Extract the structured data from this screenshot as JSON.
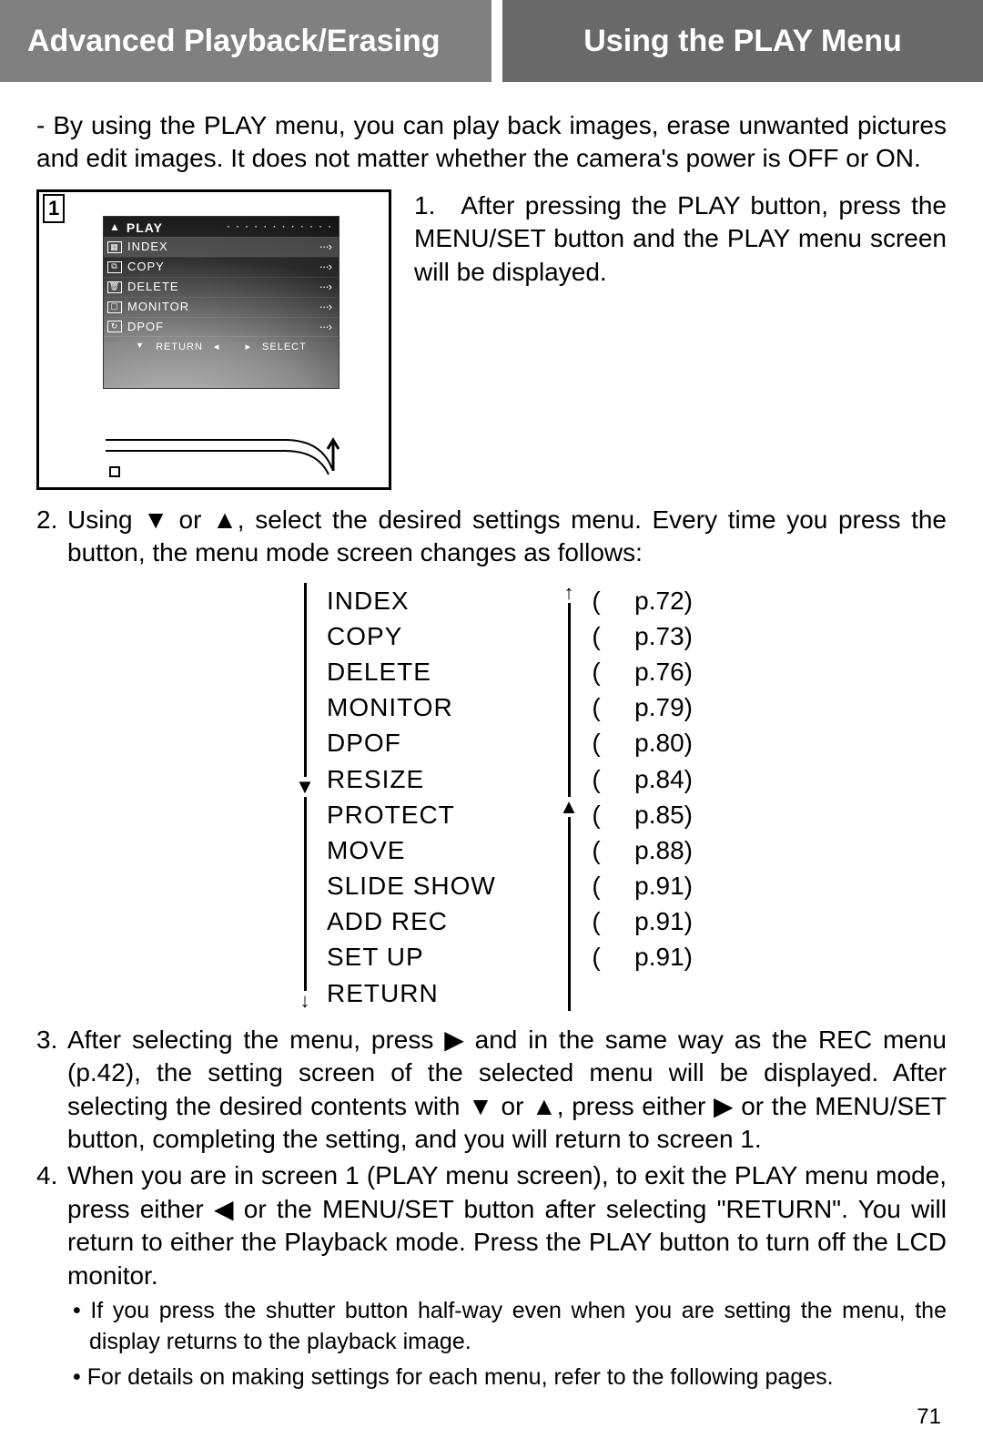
{
  "header": {
    "left": "Advanced Playback/Erasing",
    "right": "Using the PLAY Menu"
  },
  "intro": "- By using the PLAY menu, you can play back images, erase unwanted pictures and edit images. It does not matter whether the camera's power is OFF or ON.",
  "lcd": {
    "step_number": "1",
    "title": "PLAY",
    "items": [
      {
        "label": "INDEX",
        "selected": true
      },
      {
        "label": "COPY",
        "selected": false
      },
      {
        "label": "DELETE",
        "selected": false
      },
      {
        "label": "MONITOR",
        "selected": false
      },
      {
        "label": "DPOF",
        "selected": false
      }
    ],
    "footer_left": "RETURN",
    "footer_right": "SELECT"
  },
  "step1": "1. After pressing the PLAY button, press the MENU/SET button and the PLAY menu screen will be displayed.",
  "step2": {
    "num": "2.",
    "text_a": "Using ",
    "text_b": " or ",
    "text_c": ", select the desired settings menu. Every time you press the button, the menu mode screen changes as follows:"
  },
  "menu_list": [
    {
      "name": "INDEX",
      "page": "p.72)"
    },
    {
      "name": "COPY",
      "page": "p.73)"
    },
    {
      "name": "DELETE",
      "page": "p.76)"
    },
    {
      "name": "MONITOR",
      "page": "p.79)"
    },
    {
      "name": "DPOF",
      "page": "p.80)"
    },
    {
      "name": "RESIZE",
      "page": "p.84)"
    },
    {
      "name": "PROTECT",
      "page": "p.85)"
    },
    {
      "name": "MOVE",
      "page": "p.88)"
    },
    {
      "name": "SLIDE SHOW",
      "page": "p.91)"
    },
    {
      "name": "ADD REC",
      "page": "p.91)"
    },
    {
      "name": "SET UP",
      "page": "p.91)"
    },
    {
      "name": "RETURN",
      "page": ""
    }
  ],
  "step3": {
    "num": "3.",
    "text_a": "After selecting the menu, press ",
    "text_b": " and in the same way as the REC menu (p.42), the setting screen of the selected menu will be displayed.  After selecting the desired contents with ",
    "text_c": " or ",
    "text_d": ", press either ",
    "text_e": " or the MENU/SET button, completing the setting, and you will return to screen 1."
  },
  "step4": {
    "num": "4.",
    "text_a": "When you are in screen 1 (PLAY menu screen), to exit the PLAY menu mode, press either ",
    "text_b": " or the MENU/SET button after selecting \"RETURN\". You will return to either the Playback mode.  Press the PLAY button to turn off the LCD monitor."
  },
  "notes": [
    "If you press the shutter button half-way even when you are setting the menu, the display returns to the playback image.",
    "For details on making settings for each menu, refer to the following pages."
  ],
  "page_number": "71"
}
